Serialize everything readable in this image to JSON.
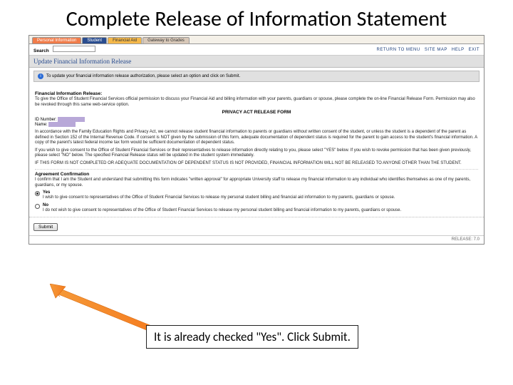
{
  "slide": {
    "title": "Complete Release of Information Statement",
    "callout": "It is already checked \"Yes\".  Click Submit."
  },
  "tabs": {
    "personal": "Personal Information",
    "student": "Student",
    "finaid": "Financial Aid",
    "gateway": "Gateway to Grades"
  },
  "search": {
    "label": "Search"
  },
  "toplinks": {
    "menu": "RETURN TO MENU",
    "sitemap": "SITE MAP",
    "help": "HELP",
    "exit": "EXIT"
  },
  "page": {
    "heading": "Update Financial Information Release"
  },
  "intro": {
    "text": "To update your financial information release authorization, please select an option and click on Submit."
  },
  "section1": {
    "heading": "Financial Information Release:",
    "body": "To give the Office of Student Financial Services official permission to discuss your Financial Aid and billing information with your parents, guardians or spouse, please complete the on-line Financial Release Form. Permission may also be revoked through this same web-service option."
  },
  "privacy": {
    "heading": "PRIVACY ACT RELEASE FORM"
  },
  "id": {
    "id_label": "ID Number:",
    "name_label": "Name:"
  },
  "para1": "In accordance with the Family Education Rights and Privacy Act, we cannot release student financial information to parents or guardians without written consent of the student, or unless the student is a dependent of the parent as defined in Section 152 of the Internal Revenue Code. If consent is NOT given by the submission of this form, adequate documentation of dependent status is required for the parent to gain access to the student's financial information. A copy of the parent's latest federal income tax form would be sufficient documentation of dependent status.",
  "para2": "If you wish to give consent to the Office of Student Financial Services or their representatives to release information directly relating to you, please select \"YES\" below. If you wish to revoke permission that has been given previously, please select \"NO\" below. The specified Financial Release status will be updated in the student system immediately.",
  "para3": "IF THIS FORM IS NOT COMPLETED OR ADEQUATE DOCUMENTATION OF DEPENDENT STATUS IS NOT PROVIDED, FINANCIAL INFORMATION WILL NOT BE RELEASED TO ANYONE OTHER THAN THE STUDENT.",
  "agreement": {
    "heading": "Agreement Confirmation",
    "body": "I confirm that I am the Student and understand that submitting this form indicates \"written approval\" for appropriate University staff to release my financial information to any individual who identifies themselves as one of my parents, guardians, or my spouse."
  },
  "options": {
    "yes_label": "Yes",
    "yes_body": "I wish to give consent to representatives of the Office of Student Financial Services to release my personal student billing and financial aid information to my parents, guardians or spouse.",
    "no_label": "No",
    "no_body": "I do not wish to give consent to representatives of the Office of Student Financial Services to release my personal student billing and financial information to my parents, guardians or spouse."
  },
  "buttons": {
    "submit": "Submit"
  },
  "footer": {
    "release": "RELEASE: 7.0"
  }
}
